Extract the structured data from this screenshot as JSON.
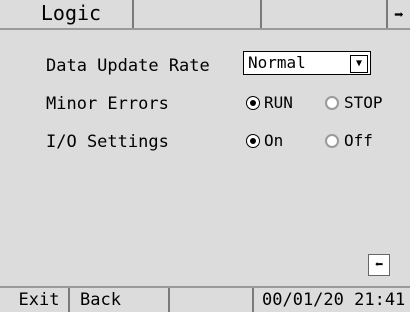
{
  "tabs": [
    {
      "label": "Logic"
    },
    {
      "label": ""
    },
    {
      "label": ""
    }
  ],
  "settings": {
    "data_update_rate": {
      "label": "Data Update Rate",
      "value": "Normal"
    },
    "minor_errors": {
      "label": "Minor Errors",
      "options": [
        "RUN",
        "STOP"
      ],
      "selected": "RUN"
    },
    "io_settings": {
      "label": "I/O Settings",
      "options": [
        "On",
        "Off"
      ],
      "selected": "On"
    }
  },
  "icons": {
    "next": "arrow-right-icon",
    "prev": "arrow-left-icon",
    "dropdown": "triangle-down-icon"
  },
  "footer": {
    "exit_label": "Exit",
    "back_label": "Back",
    "clock": "00/01/20 21:41"
  }
}
